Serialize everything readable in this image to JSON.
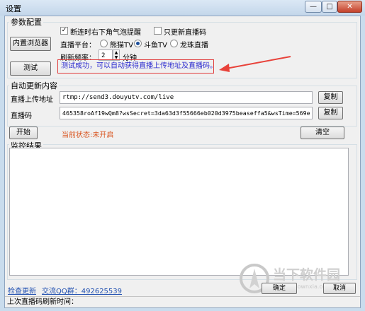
{
  "window": {
    "title": "设置",
    "minimize_glyph": "—",
    "maximize_glyph": "□",
    "close_glyph": "✕"
  },
  "params": {
    "group_label": "参数配置",
    "builtin_browser_button": "内置浏览器",
    "disconnect_notify": {
      "label": "断连时右下角气泡提醒",
      "checked": true
    },
    "only_update_url": {
      "label": "只更新直播码",
      "checked": false
    },
    "platform_label": "直播平台：",
    "platforms": [
      {
        "label": "熊猫TV",
        "selected": false
      },
      {
        "label": "斗鱼TV",
        "selected": true
      },
      {
        "label": "龙珠直播",
        "selected": false
      }
    ],
    "refresh_label": "刷新频率：",
    "refresh_value": "2",
    "refresh_unit": "分钟",
    "test_button": "测试",
    "test_message": "测试成功，可以自动获得直播上传地址及直播码。"
  },
  "auto_update": {
    "group_label": "自动更新内容",
    "upload_url_label": "直播上传地址",
    "upload_url_value": "rtmp://send3.douyutv.com/live",
    "stream_code_label": "直播码",
    "stream_code_value": "465358roAf19wQm8?wsSecret=3da63d3f55666eb020d3975beaseffa5&wsTime=569e",
    "copy_button": "复制"
  },
  "controls": {
    "start_button": "开始",
    "status_text": "当前状态:未开启",
    "clear_button": "清空"
  },
  "monitor": {
    "group_label": "监控结果"
  },
  "footer": {
    "check_update_link": "检查更新",
    "qq_group_link": "交流QQ群：492625539",
    "ok_button": "确定",
    "cancel_button": "取消",
    "status_bar": "上次直播码刷新时间："
  },
  "watermark": {
    "name": "当下软件园",
    "url": "www.downxia.com"
  },
  "colors": {
    "status_text": "#d9541e",
    "message_text": "#2c2cd0",
    "message_border": "#e03b3b",
    "annotation_arrow": "#e8423a",
    "link": "#1f4fb0"
  }
}
